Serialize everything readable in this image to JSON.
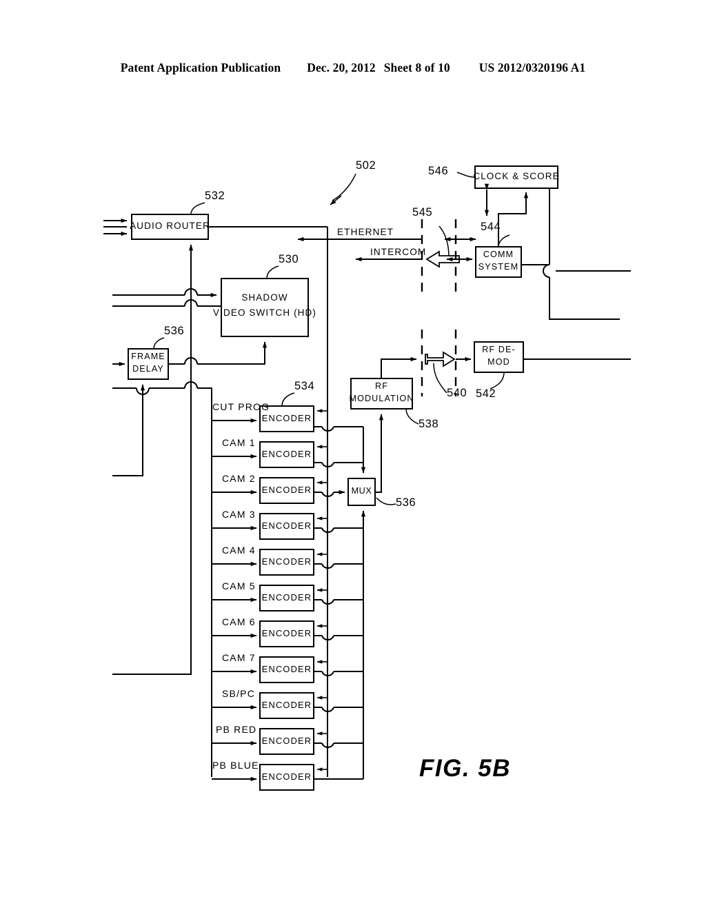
{
  "header": {
    "publication": "Patent Application Publication",
    "date": "Dec. 20, 2012",
    "sheet": "Sheet 8 of 10",
    "number": "US 2012/0320196 A1"
  },
  "figure": {
    "label": "FIG.  5B",
    "system_ref": "502"
  },
  "blocks": {
    "audio_router": {
      "label": "AUDIO ROUTER",
      "ref": "532"
    },
    "shadow_video_switch": {
      "line1": "SHADOW",
      "line2": "VIDEO SWITCH (HD)",
      "ref": "530"
    },
    "frame_delay": {
      "line1": "FRAME",
      "line2": "DELAY",
      "ref": "536"
    },
    "rf_modulation": {
      "line1": "RF",
      "line2": "MODULATION",
      "ref": "538"
    },
    "rf_demod": {
      "line1": "RF DE-",
      "line2": "MOD",
      "ref": "542"
    },
    "comm_system": {
      "line1": "COMM",
      "line2": "SYSTEM",
      "ref": "544"
    },
    "clock_score": {
      "label": "CLOCK  &  SCORE",
      "ref": "546"
    },
    "mux": {
      "label": "MUX",
      "ref": "536"
    },
    "encoder": {
      "label": "ENCODER",
      "ref": "534"
    }
  },
  "links": {
    "ethernet": "ETHERNET",
    "intercom": "INTERCOM",
    "wireless_link_ref": "545",
    "rf_link_ref": "540"
  },
  "encoder_rows": [
    {
      "signal": "CUT PROG"
    },
    {
      "signal": "CAM 1"
    },
    {
      "signal": "CAM 2"
    },
    {
      "signal": "CAM 3"
    },
    {
      "signal": "CAM 4"
    },
    {
      "signal": "CAM 5"
    },
    {
      "signal": "CAM 6"
    },
    {
      "signal": "CAM 7"
    },
    {
      "signal": "SB/PC"
    },
    {
      "signal": "PB RED"
    },
    {
      "signal": "PB BLUE"
    }
  ],
  "colors": {
    "ink": "#000000",
    "paper": "#ffffff"
  }
}
